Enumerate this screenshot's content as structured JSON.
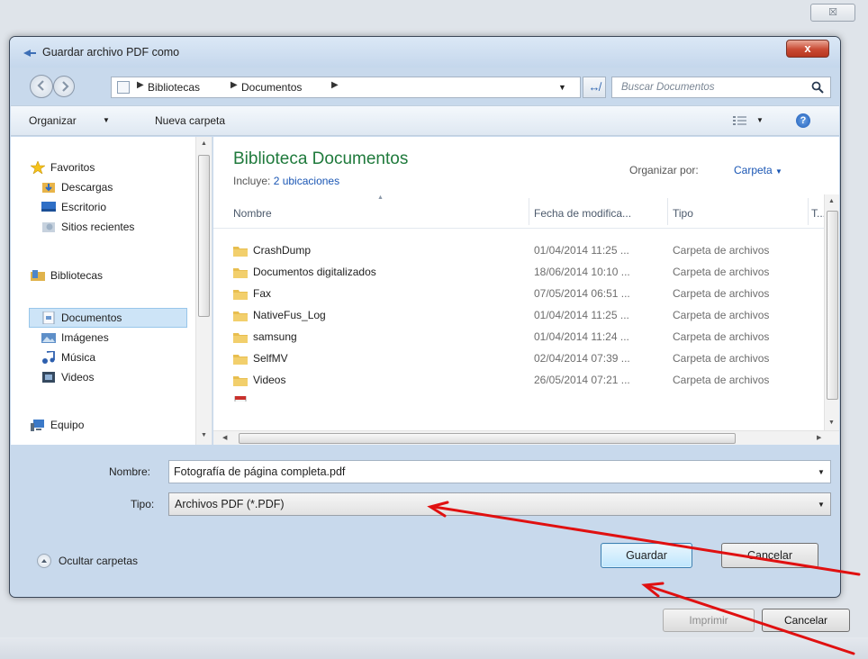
{
  "background_window": {
    "close_glyph": "☒",
    "print_label": "Imprimir",
    "cancel_label": "Cancelar"
  },
  "dialog": {
    "title": "Guardar archivo PDF como",
    "close_glyph": "x"
  },
  "address_bar": {
    "crumbs": [
      "Bibliotecas",
      "Documentos"
    ],
    "search_placeholder": "Buscar Documentos"
  },
  "toolbar": {
    "organize_label": "Organizar",
    "new_folder_label": "Nueva carpeta"
  },
  "nav_pane": {
    "items": [
      {
        "label": "Favoritos",
        "icon": "star-icon"
      },
      {
        "label": "Descargas",
        "icon": "downloads-icon"
      },
      {
        "label": "Escritorio",
        "icon": "desktop-icon"
      },
      {
        "label": "Sitios recientes",
        "icon": "recent-places-icon"
      },
      {
        "label": "Bibliotecas",
        "icon": "libraries-icon"
      },
      {
        "label": "Documentos",
        "icon": "documents-icon",
        "selected": true
      },
      {
        "label": "Imágenes",
        "icon": "pictures-icon"
      },
      {
        "label": "Música",
        "icon": "music-icon"
      },
      {
        "label": "Videos",
        "icon": "videos-icon"
      },
      {
        "label": "Equipo",
        "icon": "computer-icon"
      }
    ]
  },
  "file_pane": {
    "library_title": "Biblioteca Documentos",
    "includes_label": "Incluye:",
    "includes_link": "2 ubicaciones",
    "arrange_label": "Organizar por:",
    "arrange_value": "Carpeta",
    "columns": [
      "Nombre",
      "Fecha de modifica...",
      "Tipo",
      "T..."
    ],
    "rows": [
      {
        "name": "CrashDump",
        "date": "01/04/2014 11:25 ...",
        "type": "Carpeta de archivos"
      },
      {
        "name": "Documentos digitalizados",
        "date": "18/06/2014 10:10 ...",
        "type": "Carpeta de archivos"
      },
      {
        "name": "Fax",
        "date": "07/05/2014 06:51 ...",
        "type": "Carpeta de archivos"
      },
      {
        "name": "NativeFus_Log",
        "date": "01/04/2014 11:25 ...",
        "type": "Carpeta de archivos"
      },
      {
        "name": "samsung",
        "date": "01/04/2014 11:24 ...",
        "type": "Carpeta de archivos"
      },
      {
        "name": "SelfMV",
        "date": "02/04/2014 07:39 ...",
        "type": "Carpeta de archivos"
      },
      {
        "name": "Videos",
        "date": "26/05/2014 07:21 ...",
        "type": "Carpeta de archivos"
      }
    ]
  },
  "form": {
    "name_label": "Nombre:",
    "name_value": "Fotografía de página completa.pdf",
    "type_label": "Tipo:",
    "type_value": "Archivos PDF (*.PDF)",
    "hide_folders_label": "Ocultar carpetas",
    "save_label": "Guardar",
    "cancel_label": "Cancelar"
  },
  "colors": {
    "library_title": "#1f7a3c",
    "link": "#1a56b4",
    "annotation_arrow": "#e01010",
    "close_button": "#c94a33"
  }
}
